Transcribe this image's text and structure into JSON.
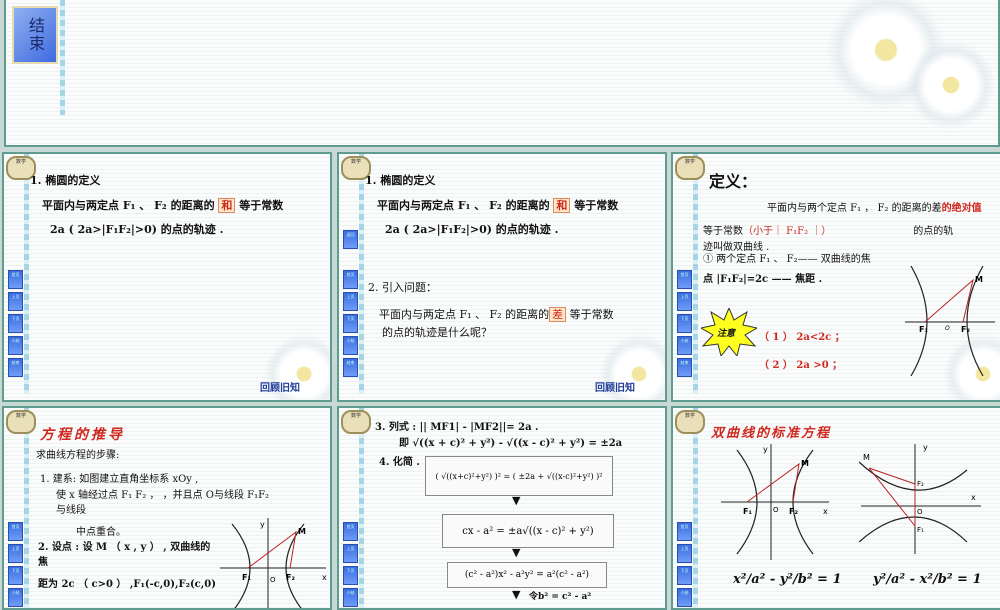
{
  "slide_end": {
    "end_button": "结束"
  },
  "logo_text": "数学",
  "nav": [
    "首页",
    "上页",
    "下页",
    "小结",
    "结束"
  ],
  "slide1": {
    "title": "1. 椭圆的定义",
    "line1a": "平面内与两定点 F₁ 、 F₂ 的距离的",
    "line1_hl": "和",
    "line1b": "等于常数",
    "line2": "2a ( 2a>|F₁F₂|>0) 的点的轨迹 .",
    "review": "回顾旧知"
  },
  "slide2": {
    "title": "1. 椭圆的定义",
    "line1a": "平面内与两定点 F₁ 、 F₂ 的距离的",
    "line1_hl": "和",
    "line1b": "等于常数",
    "line2": "2a ( 2a>|F₁F₂|>0) 的点的轨迹 .",
    "q_title": "2. 引入问题：",
    "q1a": "平面内与两定点 F₁ 、 F₂ 的距离的",
    "q1_hl": "差",
    "q1b": "等于常数",
    "q2": "的点的轨迹是什么呢？",
    "review": "回顾旧知",
    "extra_nav": "返回"
  },
  "slide3": {
    "title": "定义：",
    "l1": "平面内与两个定点 F₁ ， F₂ 的距离的差",
    "l1_red": "的绝对值",
    "l2a": "等于常数",
    "l2_red": "（小于｜ F₁F₂ ｜）",
    "l2b": "的点的轨",
    "l3": "迹叫做双曲线 .",
    "l4": "① 两个定点 F₁ 、 F₂—— 双曲线的焦",
    "l5": "点 |F₁F₂|=2c —— 焦距 .",
    "note": "注意",
    "c1": "（ 1 ） 2a<2c ；",
    "c2": "（ 2 ） 2a >0 ；",
    "labels": {
      "M": "M",
      "F1": "F₁",
      "O": "O",
      "F2": "F₂"
    }
  },
  "slide4": {
    "title": "方程的推导",
    "l1": "求曲线方程的步骤:",
    "l2": "1. 建系: 如图建立直角坐标系 xOy ,",
    "l3": "使 x 轴经过点 F₁ F₂ ，  ，并且点 O与线段 F₁F₂",
    "l4": "与线段",
    "l5": "中点重合。",
    "l6": "2. 设点 : 设 M （ x , y ） , 双曲线的",
    "l7": "焦",
    "l8": "距为 2c （ c>0 ） ,F₁(-c,0),F₂(c,0)",
    "labels": {
      "y": "y",
      "x": "x",
      "M": "M",
      "F1": "F₁",
      "O": "O",
      "F2": "F₂"
    }
  },
  "slide5": {
    "l1": "3. 列式 : || MF1| - |MF2||=   2a  .",
    "l2": "即  √((x + c)² + y²) - √((x - c)² + y²)  = ±2a",
    "l3": "4. 化简 .",
    "box1": "( √((x+c)²+y²) )² = ( ±2a + √((x-c)²+y²) )²",
    "box2": "cx - a² = ±a√((x - c)² + y²)",
    "box3": "(c² - a²)x² - a²y² = a²(c² - a²)",
    "let": "令b² = c² - a²"
  },
  "slide6": {
    "title": "双曲线的标准方程",
    "eq1": "x²/a² - y²/b² = 1",
    "eq2": "y²/a² - x²/b² = 1",
    "labels1": {
      "y": "y",
      "x": "x",
      "M": "M",
      "F1": "F₁",
      "O": "O",
      "F2": "F₂"
    },
    "labels2": {
      "y": "y",
      "x": "x",
      "M": "M",
      "F1": "F₁",
      "O": "O",
      "F2": "F₂"
    }
  }
}
